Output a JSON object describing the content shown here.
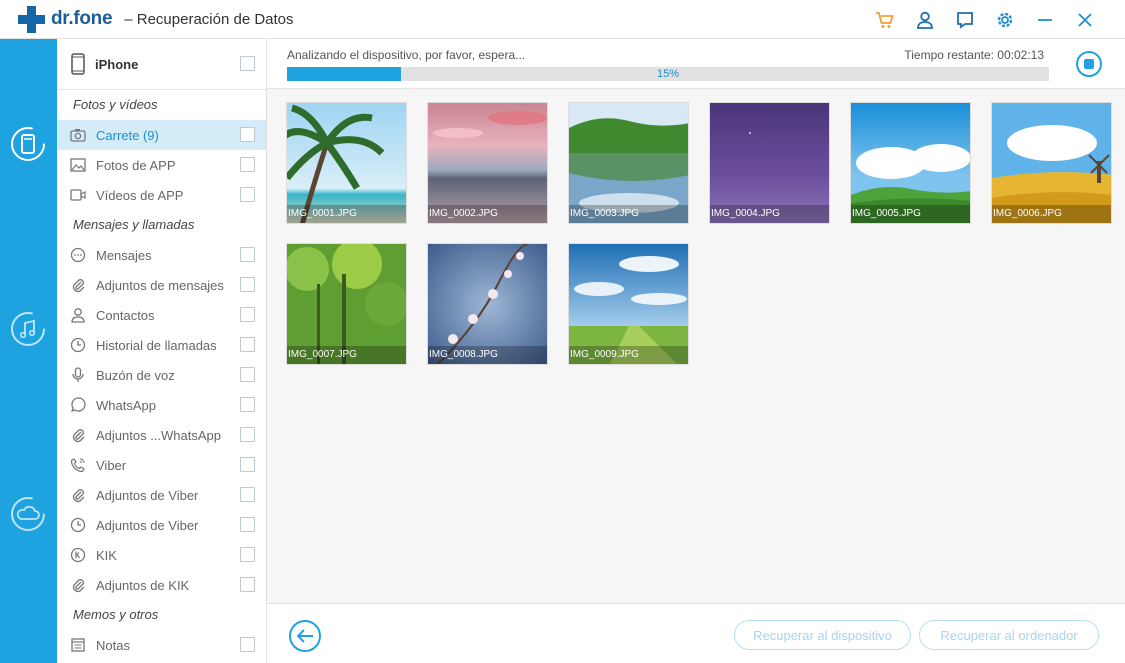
{
  "titlebar": {
    "logo_text": "dr.fone",
    "app_title": "– Recuperación de Datos",
    "icons": [
      "cart-icon",
      "user-icon",
      "feedback-icon",
      "settings-icon",
      "minimize-icon",
      "close-icon"
    ],
    "accent_cart": "#f0a030",
    "accent_icons": "#1e8ed2"
  },
  "rail": {
    "color": "#1ea3e0",
    "items": [
      "device-recover-icon",
      "itunes-recover-icon",
      "icloud-recover-icon"
    ]
  },
  "sidebar": {
    "device": "iPhone",
    "sections": [
      {
        "title": "Fotos y vídeos",
        "items": [
          {
            "label": "Carrete (9)",
            "icon": "camera-icon"
          },
          {
            "label": "Fotos de APP",
            "icon": "image-icon"
          },
          {
            "label": "Vídeos de APP",
            "icon": "video-icon"
          }
        ]
      },
      {
        "title": "Mensajes y llamadas",
        "items": [
          {
            "label": "Mensajes",
            "icon": "message-icon"
          },
          {
            "label": "Adjuntos de mensajes",
            "icon": "paperclip-icon"
          },
          {
            "label": "Contactos",
            "icon": "contact-icon"
          },
          {
            "label": "Historial de llamadas",
            "icon": "clock-icon"
          },
          {
            "label": "Buzón de voz",
            "icon": "microphone-icon"
          },
          {
            "label": "WhatsApp",
            "icon": "whatsapp-icon"
          },
          {
            "label": "Adjuntos ...WhatsApp",
            "icon": "paperclip-icon"
          },
          {
            "label": "Viber",
            "icon": "phone-icon"
          },
          {
            "label": "Adjuntos de Viber",
            "icon": "paperclip-icon"
          },
          {
            "label": "Adjuntos de Viber",
            "icon": "clock-icon"
          },
          {
            "label": "KIK",
            "icon": "kik-icon"
          },
          {
            "label": "Adjuntos de KIK",
            "icon": "paperclip-icon"
          }
        ]
      },
      {
        "title": "Memos y otros",
        "items": [
          {
            "label": "Notas",
            "icon": "notes-icon"
          }
        ]
      }
    ],
    "active_color": "#d4ebf8"
  },
  "progress": {
    "status": "Analizando el dispositivo, por favor, espera...",
    "remaining": "Tiempo restante: 00:02:13",
    "percent_value": 0.15,
    "percent_text": "15%"
  },
  "thumbnails": [
    {
      "name": "IMG_0001.JPG",
      "scene": "palm-beach"
    },
    {
      "name": "IMG_0002.JPG",
      "scene": "pink-sunset"
    },
    {
      "name": "IMG_0003.JPG",
      "scene": "lake-forest"
    },
    {
      "name": "IMG_0004.JPG",
      "scene": "purple-sky"
    },
    {
      "name": "IMG_0005.JPG",
      "scene": "green-field-sky"
    },
    {
      "name": "IMG_0006.JPG",
      "scene": "windmill-field"
    },
    {
      "name": "IMG_0007.JPG",
      "scene": "green-forest"
    },
    {
      "name": "IMG_0008.JPG",
      "scene": "blossom"
    },
    {
      "name": "IMG_0009.JPG",
      "scene": "meadow-clouds"
    }
  ],
  "bottom": {
    "recover_device": "Recuperar al dispositivo",
    "recover_computer": "Recuperar al ordenador"
  }
}
